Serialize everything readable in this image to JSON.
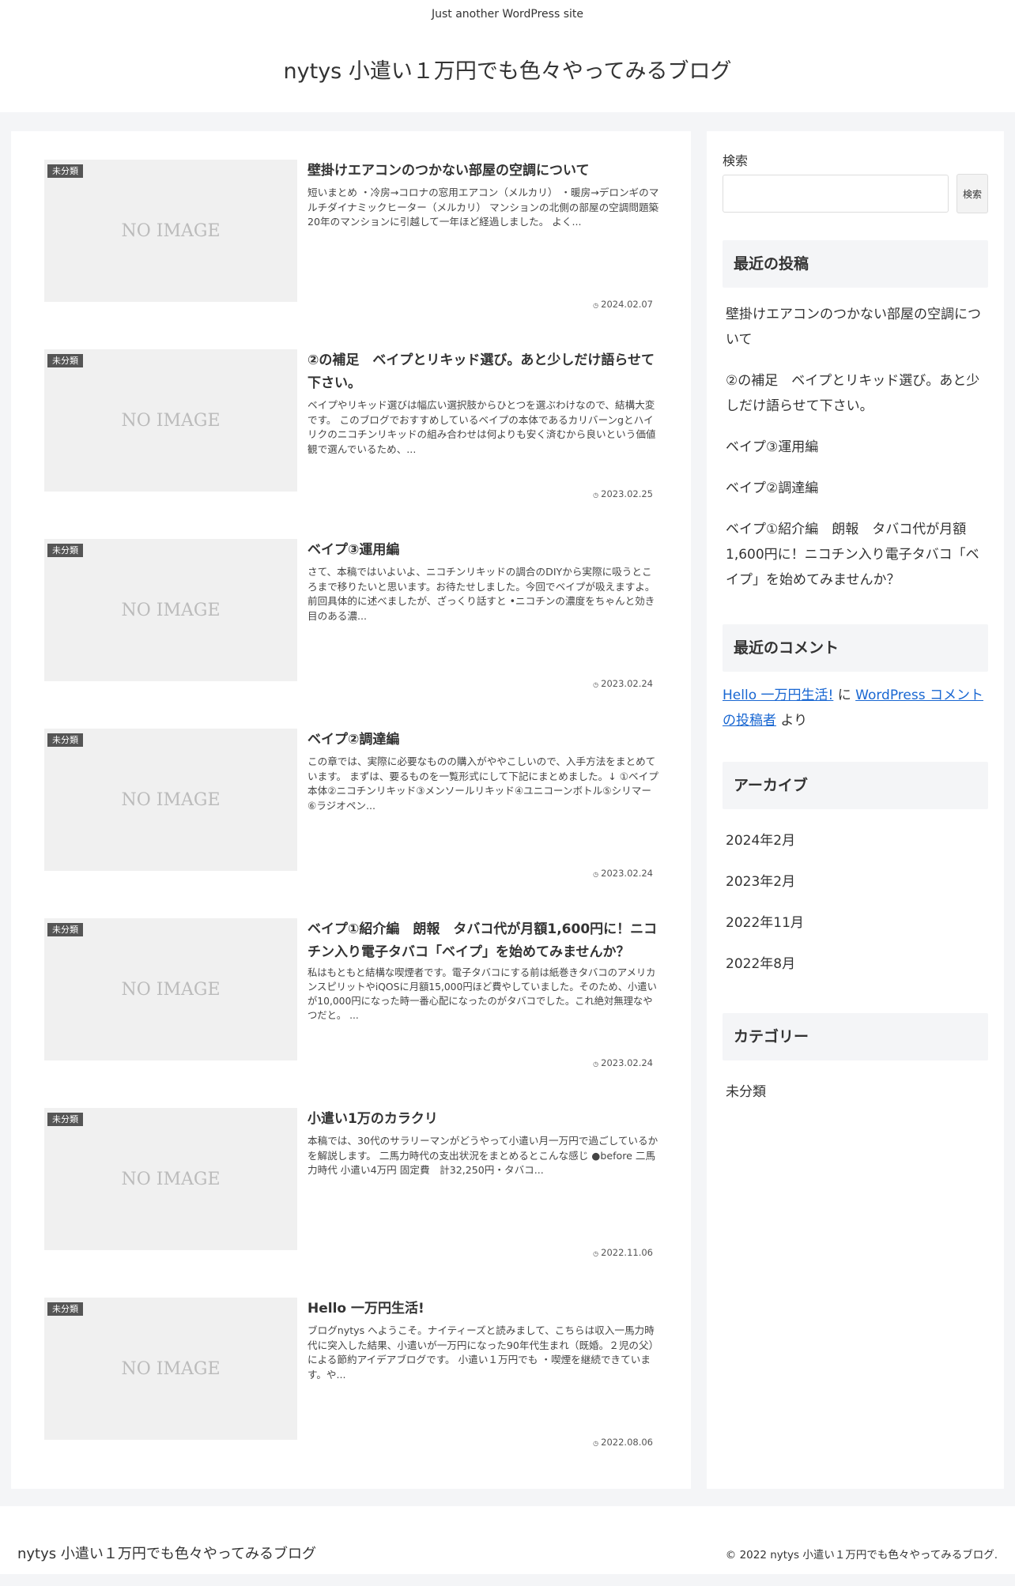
{
  "header": {
    "tagline": "Just another WordPress site",
    "site_title": "nytys 小遣い１万円でも色々やってみるブログ"
  },
  "posts": [
    {
      "category": "未分類",
      "thumb_text": "NO IMAGE",
      "title": "壁掛けエアコンのつかない部屋の空調について",
      "snippet": "短いまとめ ・冷房→コロナの窓用エアコン（メルカリ） ・暖房→デロンギのマルチダイナミックヒーター（メルカリ） マンションの北側の部屋の空調問題築20年のマンションに引越して一年ほど経過しました。 よく...",
      "date": "2024.02.07"
    },
    {
      "category": "未分類",
      "thumb_text": "NO IMAGE",
      "title": "②の補足　ベイプとリキッド選び。あと少しだけ語らせて下さい。",
      "snippet": "ベイプやリキッド選びは幅広い選択肢からひとつを選ぶわけなので、結構大変です。 このブログでおすすめしているベイプの本体であるカリバーンgとハイリクのニコチンリキッドの組み合わせは何よりも安く済むから良いという価値観で選んでいるため、...",
      "date": "2023.02.25"
    },
    {
      "category": "未分類",
      "thumb_text": "NO IMAGE",
      "title": "ベイプ③運用編",
      "snippet": "さて、本稿ではいよいよ、ニコチンリキッドの調合のDIYから実際に吸うところまで移りたいと思います。お待たせしました。今回でベイプが吸えますよ。 前回具体的に述べましたが、ざっくり話すと •ニコチンの濃度をちゃんと効き目のある濃...",
      "date": "2023.02.24"
    },
    {
      "category": "未分類",
      "thumb_text": "NO IMAGE",
      "title": "ベイプ②調達編",
      "snippet": "この章では、実際に必要なものの購入がややこしいので、入手方法をまとめています。 まずは、要るものを一覧形式にして下記にまとめました。↓ ①ベイプ本体②ニコチンリキッド③メンソールリキッド④ユニコーンボトル⑤シリマー⑥ラジオペン...",
      "date": "2023.02.24"
    },
    {
      "category": "未分類",
      "thumb_text": "NO IMAGE",
      "title": "ベイプ①紹介編　朗報　タバコ代が月額1,600円に！ニコチン入り電子タバコ「ベイプ」を始めてみませんか？",
      "snippet": "私はもともと結構な喫煙者です。電子タバコにする前は紙巻きタバコのアメリカンスピリットやiQOSに月額15,000円ほど費やしていました。そのため、小遣いが10,000円になった時一番心配になったのがタバコでした。これ絶対無理なやつだと。 ...",
      "date": "2023.02.24"
    },
    {
      "category": "未分類",
      "thumb_text": "NO IMAGE",
      "title": "小遣い1万のカラクリ",
      "snippet": "本稿では、30代のサラリーマンがどうやって小遣い月一万円で過ごしているかを解説します。 二馬力時代の支出状況をまとめるとこんな感じ ●before 二馬力時代 小遣い4万円 固定費　計32,250円・タバコ...",
      "date": "2022.11.06"
    },
    {
      "category": "未分類",
      "thumb_text": "NO IMAGE",
      "title": "Hello 一万円生活!",
      "snippet": "ブログnytys へようこそ。ナイティーズと読みまして、こちらは収入一馬力時代に突入した結果、小遣いが一万円になった90年代生まれ（既婚。２児の父）による節約アイデアブログです。 小遣い１万円でも ・喫煙を継続できています。や...",
      "date": "2022.08.06"
    }
  ],
  "sidebar": {
    "search": {
      "label": "検索",
      "button": "検索",
      "value": ""
    },
    "recent_posts": {
      "title": "最近の投稿",
      "items": [
        "壁掛けエアコンのつかない部屋の空調について",
        "②の補足　ベイプとリキッド選び。あと少しだけ語らせて下さい。",
        "ベイプ③運用編",
        "ベイプ②調達編",
        "ベイプ①紹介編　朗報　タバコ代が月額1,600円に！ニコチン入り電子タバコ「ベイプ」を始めてみませんか？"
      ]
    },
    "recent_comments": {
      "title": "最近のコメント",
      "author": "Hello 一万円生活!",
      "ni": "に",
      "post": "WordPress コメントの投稿者",
      "yori": "より"
    },
    "archives": {
      "title": "アーカイブ",
      "items": [
        "2024年2月",
        "2023年2月",
        "2022年11月",
        "2022年8月"
      ]
    },
    "categories": {
      "title": "カテゴリー",
      "items": [
        "未分類"
      ]
    }
  },
  "footer": {
    "site_title": "nytys 小遣い１万円でも色々やってみるブログ",
    "copyright": "© 2022 nytys 小遣い１万円でも色々やってみるブログ."
  }
}
